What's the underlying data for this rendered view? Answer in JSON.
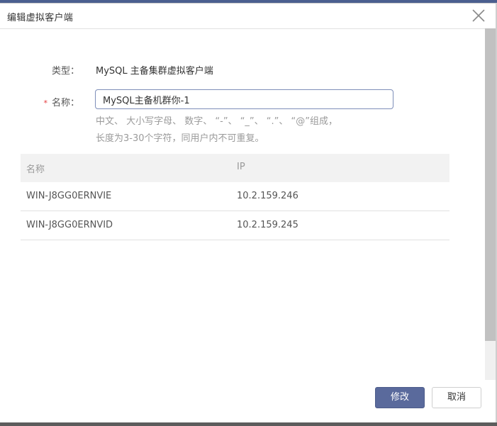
{
  "dialog": {
    "title": "编辑虚拟客户端"
  },
  "form": {
    "type_label": "类型：",
    "type_value": "MySQL 主备集群虚拟客户端",
    "required_mark": "*",
    "name_label": "名称：",
    "name_value": "MySQL主备机群你-1",
    "hint_line1": "中文、 大小写字母、 数字、 “-”、 “_”、 “.”、 “@”组成，",
    "hint_line2": "长度为3-30个字符，同用户内不可重复。"
  },
  "table": {
    "columns": [
      "名称",
      "IP"
    ],
    "rows": [
      {
        "name": "WIN-J8GG0ERNVIE",
        "ip": "10.2.159.246"
      },
      {
        "name": "WIN-J8GG0ERNVID",
        "ip": "10.2.159.245"
      }
    ]
  },
  "buttons": {
    "confirm": "修改",
    "cancel": "取消"
  },
  "colors": {
    "primary": "#5a6a9c",
    "input_border": "#7e8eb9",
    "required": "#e4393c",
    "hint": "#9a9a9a"
  },
  "icons": {
    "close": "close-icon"
  }
}
